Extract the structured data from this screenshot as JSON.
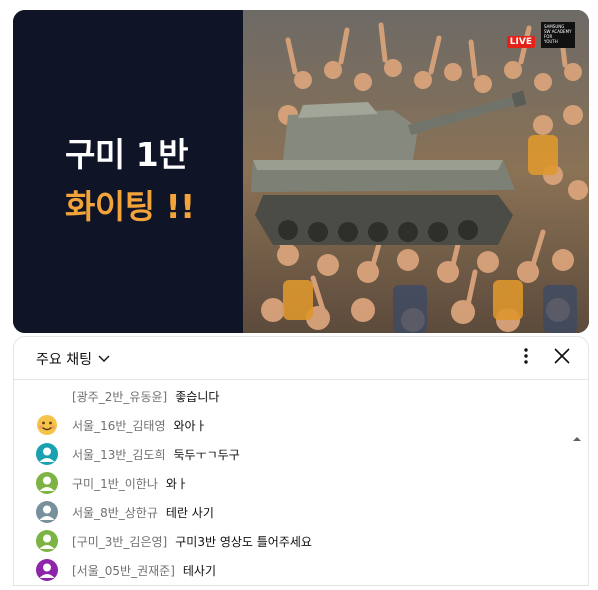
{
  "video": {
    "title_line1": "구미 1반",
    "title_line2": "화이팅 !!",
    "live_badge": "LIVE",
    "corner_logo_lines": [
      "SAMSUNG",
      "SW ACADEMY",
      "FOR",
      "YOUTH"
    ],
    "accent_color": "#f2a33a",
    "panel_bg": "#0f1426"
  },
  "chat": {
    "mode_label": "주요 채팅",
    "mode_icon": "chevron-down-icon",
    "menu_icon": "more-vert-icon",
    "close_icon": "close-icon",
    "messages": [
      {
        "author": "[광주_2반_유동윤]",
        "text": "좋습니다",
        "avatar": "none"
      },
      {
        "author": "서울_16반_김태영",
        "text": "와아ㅏ",
        "avatar": "emoji-face",
        "avatar_color": "#f6c34a"
      },
      {
        "author": "서울_13반_김도희",
        "text": "둑두ㅜㄱ두구",
        "avatar": "default-user",
        "avatar_color": "#1aa1b0"
      },
      {
        "author": "구미_1반_이한나",
        "text": "와ㅏ",
        "avatar": "default-user",
        "avatar_color": "#7cb342"
      },
      {
        "author": "서울_8반_상한규",
        "text": "테란 사기",
        "avatar": "default-user",
        "avatar_color": "#78909c"
      },
      {
        "author": "[구미_3반_김은영]",
        "text": "구미3반 영상도 틀어주세요",
        "avatar": "default-user",
        "avatar_color": "#7cb342"
      },
      {
        "author": "[서울_05반_권재준]",
        "text": "테사기",
        "avatar": "default-user",
        "avatar_color": "#8e24aa"
      }
    ]
  }
}
